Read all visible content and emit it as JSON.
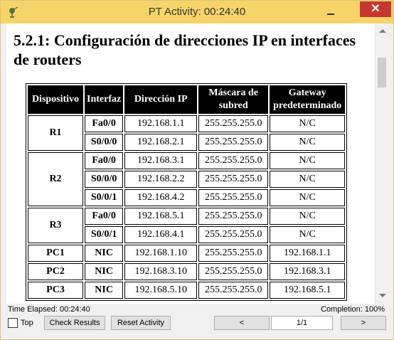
{
  "window": {
    "title": "PT Activity: 00:24:40",
    "close_glyph": "✕",
    "icons": [
      "pt-activity-icon",
      "minimize-icon",
      "close-icon"
    ]
  },
  "content": {
    "heading": "5.2.1: Configuración de direcciones IP en interfaces de routers",
    "table": {
      "headers": [
        "Dispositivo",
        "Interfaz",
        "Dirección IP",
        "Máscara de subred",
        "Gateway predeterminado"
      ],
      "groups": [
        {
          "device": "R1",
          "rows": [
            {
              "iface": "Fa0/0",
              "ip": "192.168.1.1",
              "mask": "255.255.255.0",
              "gateway": "N/C"
            },
            {
              "iface": "S0/0/0",
              "ip": "192.168.2.1",
              "mask": "255.255.255.0",
              "gateway": "N/C"
            }
          ]
        },
        {
          "device": "R2",
          "rows": [
            {
              "iface": "Fa0/0",
              "ip": "192.168.3.1",
              "mask": "255.255.255.0",
              "gateway": "N/C"
            },
            {
              "iface": "S0/0/0",
              "ip": "192.168.2.2",
              "mask": "255.255.255.0",
              "gateway": "N/C"
            },
            {
              "iface": "S0/0/1",
              "ip": "192.168.4.2",
              "mask": "255.255.255.0",
              "gateway": "N/C"
            }
          ]
        },
        {
          "device": "R3",
          "rows": [
            {
              "iface": "Fa0/0",
              "ip": "192.168.5.1",
              "mask": "255.255.255.0",
              "gateway": "N/C"
            },
            {
              "iface": "S0/0/1",
              "ip": "192.168.4.1",
              "mask": "255.255.255.0",
              "gateway": "N/C"
            }
          ]
        },
        {
          "device": "PC1",
          "rows": [
            {
              "iface": "NIC",
              "ip": "192.168.1.10",
              "mask": "255.255.255.0",
              "gateway": "192.168.1.1"
            }
          ]
        },
        {
          "device": "PC2",
          "rows": [
            {
              "iface": "NIC",
              "ip": "192.168.3.10",
              "mask": "255.255.255.0",
              "gateway": "192.168.3.1"
            }
          ]
        },
        {
          "device": "PC3",
          "rows": [
            {
              "iface": "NIC",
              "ip": "192.168.5.10",
              "mask": "255.255.255.0",
              "gateway": "192.168.5.1"
            }
          ]
        }
      ]
    }
  },
  "status": {
    "time_elapsed": "Time Elapsed: 00:24:40",
    "completion": "Completion: 100%"
  },
  "footer": {
    "top_label": "Top",
    "check_results": "Check Results",
    "reset_activity": "Reset Activity",
    "prev": "<",
    "page": "1/1",
    "next": ">"
  }
}
